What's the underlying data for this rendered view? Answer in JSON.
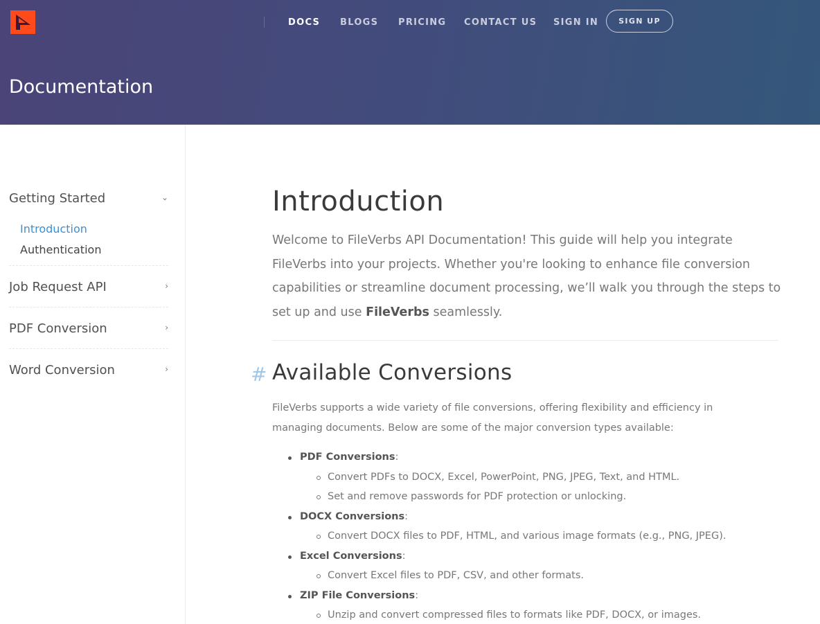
{
  "header": {
    "logo_icon": "fileverbs-logo-icon",
    "brand_color": "#ff4a1c",
    "nav": [
      "DOCS",
      "BLOGS",
      "PRICING",
      "CONTACT US",
      "SIGN IN"
    ],
    "signup_label": "SIGN UP",
    "page_title": "Documentation"
  },
  "sidebar": {
    "sections": [
      {
        "label": "Getting Started",
        "chevron": "chevron-down-icon"
      },
      {
        "label": "Job Request API",
        "chevron": "chevron-right-icon"
      },
      {
        "label": "PDF Conversion",
        "chevron": "chevron-right-icon"
      },
      {
        "label": "Word Conversion",
        "chevron": "chevron-right-icon"
      }
    ],
    "sub_items": [
      "Introduction",
      "Authentication"
    ],
    "active_item": "Introduction"
  },
  "main": {
    "title": "Introduction",
    "intro": {
      "text": "Welcome to FileVerbs API Documentation! This guide will help you integrate FileVerbs into your projects. Whether you're looking to enhance file conversion capabilities or streamline document processing, we’ll walk you through the steps to set up and use ",
      "bold": "FileVerbs",
      "after": " seamlessly."
    },
    "section": {
      "anchor": "#",
      "heading": "Available Conversions",
      "para": "FileVerbs supports a wide variety of file conversions, offering flexibility and efficiency in managing documents. Below are some of the major conversion types available:"
    },
    "list": [
      {
        "title": "PDF Conversions",
        "items": [
          "Convert PDFs to DOCX, Excel, PowerPoint, PNG, JPEG, Text, and HTML.",
          "Set and remove passwords for PDF protection or unlocking."
        ]
      },
      {
        "title": "DOCX Conversions",
        "items": [
          "Convert DOCX files to PDF, HTML, and various image formats (e.g., PNG, JPEG)."
        ]
      },
      {
        "title": "Excel Conversions",
        "items": [
          "Convert Excel files to PDF, CSV, and other formats."
        ]
      },
      {
        "title": "ZIP File Conversions",
        "items": [
          "Unzip and convert compressed files to formats like PDF, DOCX, or images."
        ]
      }
    ],
    "colon": ":"
  }
}
